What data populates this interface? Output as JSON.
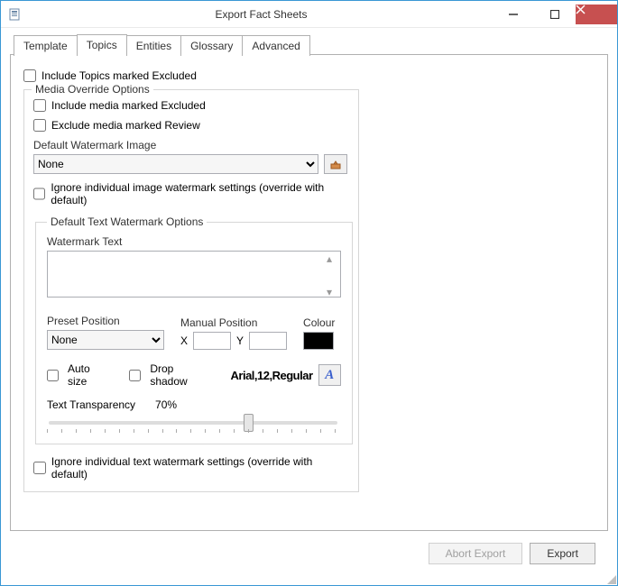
{
  "window": {
    "title": "Export Fact Sheets"
  },
  "tabs": {
    "template": "Template",
    "topics": "Topics",
    "entities": "Entities",
    "glossary": "Glossary",
    "advanced": "Advanced"
  },
  "topics_tab": {
    "include_excluded": "Include Topics marked Excluded",
    "media_group": {
      "title": "Media Override Options",
      "include_media_excluded": "Include media marked Excluded",
      "exclude_media_review": "Exclude media marked Review",
      "default_watermark_image_label": "Default Watermark Image",
      "watermark_image_value": "None",
      "ignore_image_watermark": "Ignore individual image watermark settings (override with default)",
      "text_group": {
        "title": "Default Text Watermark Options",
        "watermark_text_label": "Watermark Text",
        "preset_position_label": "Preset Position",
        "preset_position_value": "None",
        "manual_position_label": "Manual Position",
        "x_label": "X",
        "y_label": "Y",
        "colour_label": "Colour",
        "colour_value": "#000000",
        "auto_size": "Auto size",
        "drop_shadow": "Drop shadow",
        "font_preview": "Arial,12,Regular",
        "transparency_label": "Text Transparency",
        "transparency_value": "70%"
      },
      "ignore_text_watermark": "Ignore individual text watermark settings (override with default)"
    }
  },
  "buttons": {
    "abort": "Abort Export",
    "export": "Export"
  }
}
